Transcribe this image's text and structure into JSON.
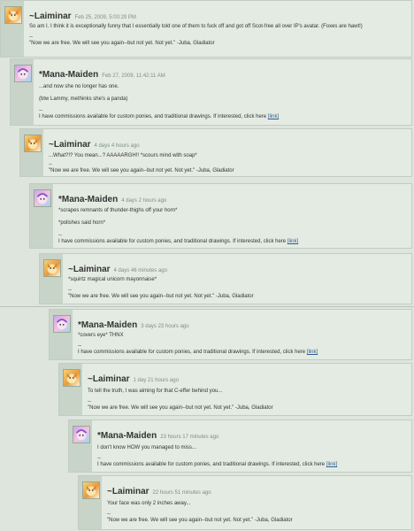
{
  "comments": [
    {
      "username": "~Laiminar",
      "timestamp": "Feb 25, 2009, 5:00:29 PM",
      "avatar": "fox",
      "lines": [
        "So am I. I think it is exceptionally funny that I essentially told one of them to fuck off and got off Scot-free all over IP's avatar. (Foxes are hawt!)"
      ],
      "sig_sep": "--",
      "signature": "\"Now we are free. We will see you again--but not yet. Not yet.\" -Juba, Gladiator"
    },
    {
      "username": "*Mana-Maiden",
      "timestamp": "Feb 27, 2009, 11:42:11 AM",
      "avatar": "pony",
      "lines": [
        "...and now she no longer has one.",
        "(btw Lammy, methinks she's a panda)"
      ],
      "sig_sep": "--",
      "signature": "I have commissions available for custom ponies, and traditional drawings. If interested, click here",
      "link": "[link]"
    },
    {
      "username": "~Laiminar",
      "timestamp": "4 days 4 hours ago",
      "avatar": "fox",
      "lines": [
        "...What?!? You mean...? AAAAARGH!! *scours mind with soap*"
      ],
      "sig_sep": "--",
      "signature": "\"Now we are free. We will see you again--but not yet. Not yet.\" -Juba, Gladiator"
    },
    {
      "username": "*Mana-Maiden",
      "timestamp": "4 days 2 hours ago",
      "avatar": "pony",
      "lines": [
        "*scrapes remnants of thunder-thighs off your horn*",
        "*polishes said horn*"
      ],
      "sig_sep": "--",
      "signature": "I have commissions available for custom ponies, and traditional drawings. If interested, click here",
      "link": "[link]"
    },
    {
      "username": "~Laiminar",
      "timestamp": "4 days 46 minutes ago",
      "avatar": "fox",
      "lines": [
        "*squirtz magical unicorn mayonnaise*"
      ],
      "sig_sep": "--",
      "signature": "\"Now we are free. We will see you again--but not yet. Not yet.\" -Juba, Gladiator"
    },
    {
      "username": "*Mana-Maiden",
      "timestamp": "3 days 23 hours ago",
      "avatar": "pony",
      "lines": [
        "*covers eye* THNX"
      ],
      "sig_sep": "--",
      "signature": "I have commissions available for custom ponies, and traditional drawings. If interested, click here",
      "link": "[link]"
    },
    {
      "username": "~Laiminar",
      "timestamp": "1 day 21 hours ago",
      "avatar": "fox",
      "lines": [
        "To tell the truth, I was aiming for that C-effer behind you..."
      ],
      "sig_sep": "--",
      "signature": "\"Now we are free. We will see you again--but not yet. Not yet.\" -Juba, Gladiator"
    },
    {
      "username": "*Mana-Maiden",
      "timestamp": "23 hours 17 minutes ago",
      "avatar": "pony",
      "lines": [
        "I don't know HOW you managed to miss..."
      ],
      "sig_sep": "--",
      "signature": "I have commissions available for custom ponies, and traditional drawings. If interested, click here",
      "link": "[link]"
    },
    {
      "username": "~Laiminar",
      "timestamp": "22 hours 51 minutes ago",
      "avatar": "fox",
      "lines": [
        "Your face was only 2 inches away..."
      ],
      "sig_sep": "--",
      "signature": "\"Now we are free. We will see you again--but not yet. Not yet.\" -Juba, Gladiator"
    }
  ]
}
